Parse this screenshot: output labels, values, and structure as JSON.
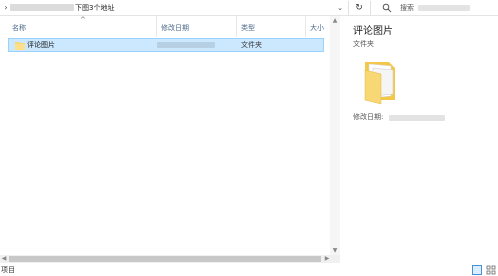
{
  "address_bar": {
    "path_tail": "下图3个地址",
    "chevron": "chevron-right-icon",
    "dropdown": "chevron-down-icon"
  },
  "toolbar": {
    "refresh": "refresh-icon"
  },
  "search": {
    "placeholder": "搜索"
  },
  "columns": {
    "name": "名称",
    "date_modified": "修改日期",
    "type": "类型",
    "size": "大小"
  },
  "files": [
    {
      "name": "评论图片",
      "type": "文件夹",
      "icon": "folder-icon"
    }
  ],
  "details": {
    "title": "评论图片",
    "subtitle": "文件夹",
    "modified_label": "修改日期:"
  },
  "status": {
    "text": "项目"
  },
  "colors": {
    "selection": "#cce8ff",
    "selection_border": "#99d1ff",
    "header_text": "#4a6a8a",
    "folder": "#f8d775"
  }
}
